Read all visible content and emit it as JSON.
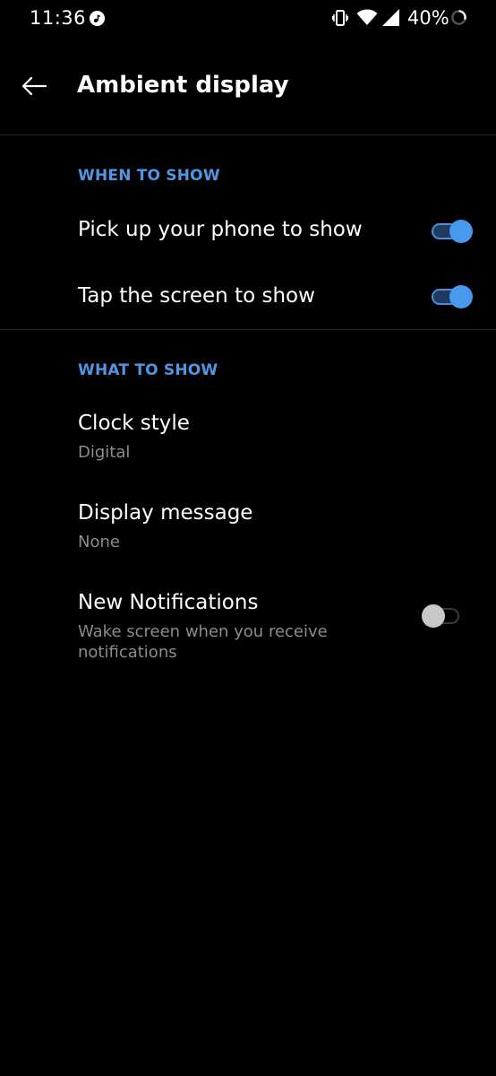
{
  "status_bar": {
    "time": "11:36",
    "battery": "40%",
    "icons": [
      "music-icon",
      "vibrate-icon",
      "wifi-icon",
      "signal-icon",
      "battery-icon"
    ]
  },
  "app_bar": {
    "title": "Ambient display",
    "back_icon": "back-arrow-icon"
  },
  "sections": {
    "when": {
      "header": "WHEN TO SHOW",
      "pickup": {
        "title": "Pick up your phone to show",
        "enabled": true
      },
      "tap": {
        "title": "Tap the screen to show",
        "enabled": true
      }
    },
    "what": {
      "header": "WHAT TO SHOW",
      "clock": {
        "title": "Clock style",
        "value": "Digital"
      },
      "message": {
        "title": "Display message",
        "value": "None"
      },
      "notifications": {
        "title": "New Notifications",
        "summary": "Wake screen when you receive notifications",
        "enabled": false
      }
    }
  },
  "colors": {
    "background": "#000000",
    "accent": "#4799ee",
    "section_header": "#4f97e5",
    "secondary_text": "#8c8c8c"
  }
}
